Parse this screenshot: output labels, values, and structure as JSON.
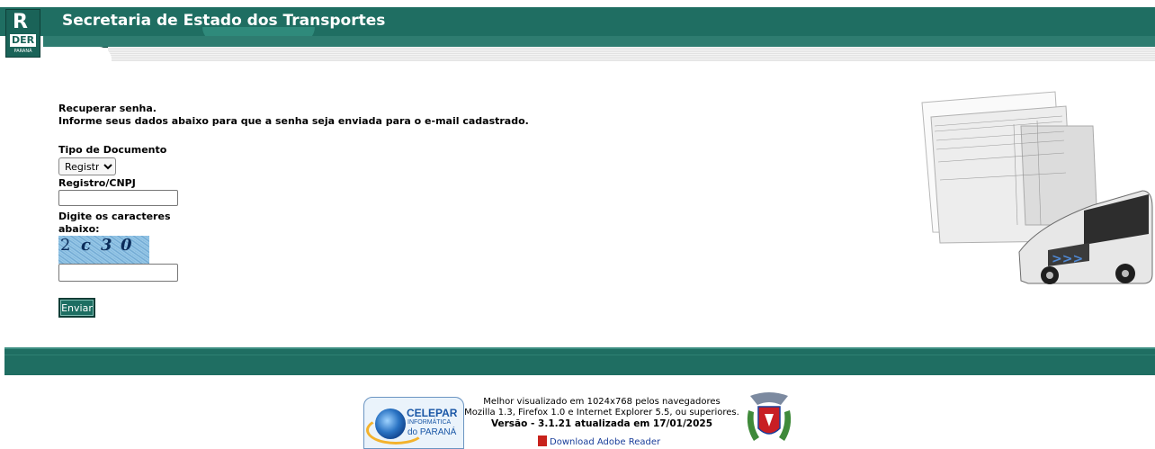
{
  "header": {
    "title": "Secretaria de Estado dos Transportes",
    "logo": {
      "line1": "R",
      "line2": "DER",
      "line3": "PARANÁ"
    }
  },
  "form": {
    "heading": "Recuperar senha.",
    "instruction": "Informe seus dados abaixo para que a senha seja enviada para o e-mail cadastrado.",
    "doc_type_label": "Tipo de Documento",
    "doc_type_selected": "Registro",
    "registro_label": "Registro/CNPJ",
    "registro_value": "",
    "captcha_label_1": "Digite os caracteres",
    "captcha_label_2": "abaixo:",
    "captcha_text": [
      "2",
      "c",
      "3",
      "0"
    ],
    "captcha_value": "",
    "submit_label": "Enviar"
  },
  "footer": {
    "celepar": {
      "name": "CELEPAR",
      "sub1": "INFORMÁTICA",
      "sub2": "do PARANÁ"
    },
    "line1": "Melhor visualizado em 1024x768 pelos navegadores",
    "line2": "Mozilla 1.3, Firefox 1.0 e Internet Explorer 5.5, ou superiores.",
    "version": "Versão - 3.1.21 atualizada em 17/01/2025",
    "adobe_link": "Download Adobe Reader"
  },
  "colors": {
    "brand": "#1f6e62",
    "link": "#1a3e9a"
  },
  "icons": [
    "der-logo-icon",
    "celepar-logo-icon",
    "pdf-icon",
    "parana-coat-of-arms-icon",
    "bus-ticket-illustration"
  ]
}
